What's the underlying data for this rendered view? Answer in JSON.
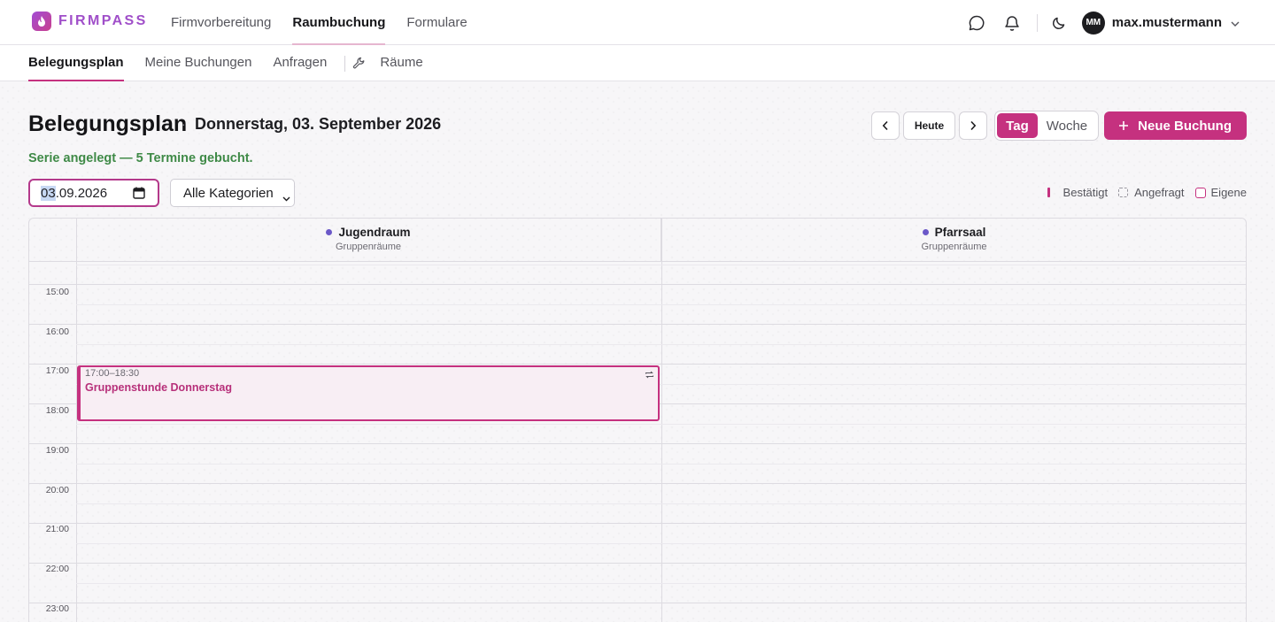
{
  "brand": {
    "name": "FIRMPASS"
  },
  "main_nav": {
    "items": [
      {
        "label": "Firmvorbereitung"
      },
      {
        "label": "Raumbuchung"
      },
      {
        "label": "Formulare"
      }
    ],
    "active": "Raumbuchung"
  },
  "user": {
    "initials": "MM",
    "name": "max.mustermann"
  },
  "sub_nav": {
    "items": [
      {
        "label": "Belegungsplan"
      },
      {
        "label": "Meine Buchungen"
      },
      {
        "label": "Anfragen"
      },
      {
        "label": "Räume"
      }
    ],
    "active": "Belegungsplan"
  },
  "page": {
    "title": "Belegungsplan",
    "separator": "·",
    "date_text": "Donnerstag, 03. September 2026",
    "series_message": "Serie angelegt — 5 Termine gebucht."
  },
  "controls": {
    "today_label": "Heute",
    "view_day": "Tag",
    "view_week": "Woche",
    "active_view": "Tag",
    "new_booking_label": "Neue Buchung"
  },
  "filters": {
    "date_value_day": "03",
    "date_value_rest": ".09.2026",
    "category_value": "Alle Kategorien"
  },
  "legend": {
    "confirmed": "Bestätigt",
    "requested": "Angefragt",
    "own": "Eigene"
  },
  "calendar": {
    "rooms": [
      {
        "name": "Jugendraum",
        "category": "Gruppenräume"
      },
      {
        "name": "Pfarrsaal",
        "category": "Gruppenräume"
      }
    ],
    "hours": [
      "15:00",
      "16:00",
      "17:00",
      "18:00",
      "19:00",
      "20:00",
      "21:00",
      "22:00",
      "23:00"
    ],
    "events": [
      {
        "room": "Jugendraum",
        "time": "17:00–18:30",
        "title": "Gruppenstunde Donnerstag",
        "recurring": true,
        "status": "Eigene"
      }
    ]
  },
  "colors": {
    "accent": "#c5317f",
    "brand": "#a04fc9",
    "success": "#3f8a47",
    "room_dot": "#6b58c8"
  }
}
